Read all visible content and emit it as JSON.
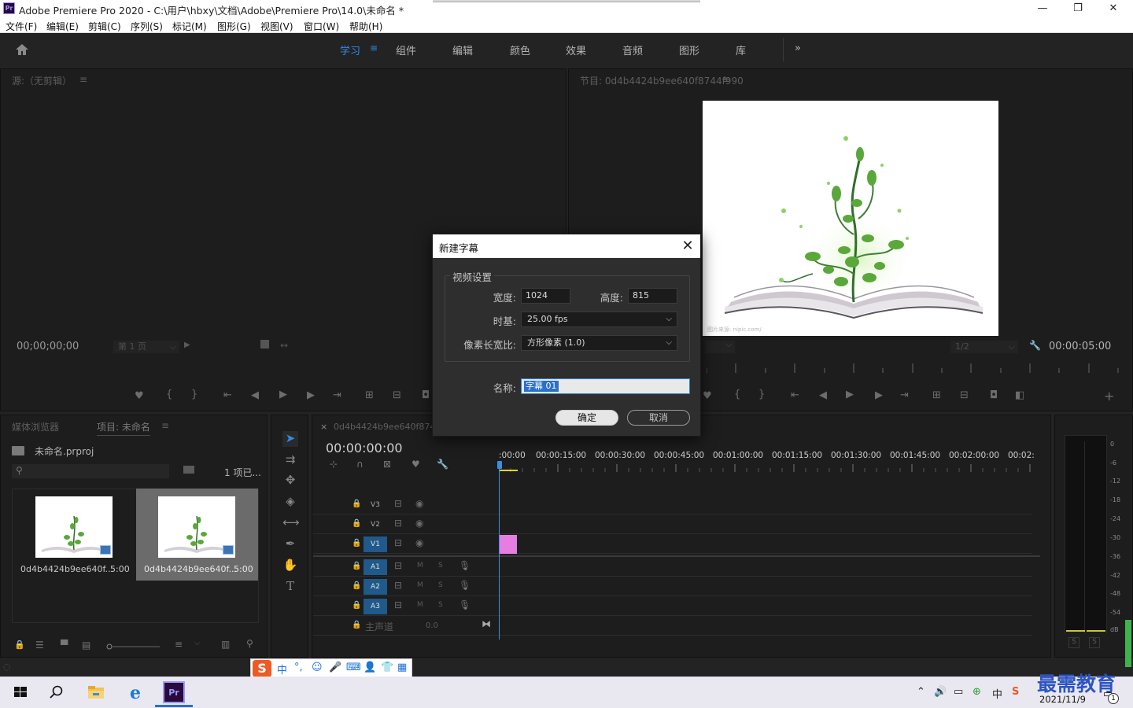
{
  "window": {
    "app_icon": "Pr",
    "title": "Adobe Premiere Pro 2020 - C:\\用户\\hbxy\\文档\\Adobe\\Premiere Pro\\14.0\\未命名 *",
    "minimize": "—",
    "maximize": "❐",
    "close": "✕"
  },
  "menu": [
    "文件(F)",
    "编辑(E)",
    "剪辑(C)",
    "序列(S)",
    "标记(M)",
    "图形(G)",
    "视图(V)",
    "窗口(W)",
    "帮助(H)"
  ],
  "workspaces": {
    "tabs": [
      "学习",
      "组件",
      "编辑",
      "颜色",
      "效果",
      "音频",
      "图形",
      "库"
    ],
    "active": "学习",
    "menu_glyph": "≡",
    "more": "»"
  },
  "source_monitor": {
    "title": "源:（无剪辑）",
    "menu_glyph": "≡",
    "timecode": "00;00;00;00",
    "page_select": "第 1 页"
  },
  "program_monitor": {
    "title": "节目: 0d4b4424b9ee640f8744f990",
    "menu_glyph": "≡",
    "timecode": "00:00:05:00",
    "resolution": "1/2",
    "frame_watermark": "图片来源: nipic.com/"
  },
  "project_panel": {
    "tabs": [
      "媒体浏览器",
      "项目: 未命名"
    ],
    "menu_glyph": "≡",
    "project_file": "未命名.prproj",
    "item_count": "1 项已...",
    "items": [
      {
        "name": "0d4b4424b9ee640f...",
        "duration": "5:00"
      },
      {
        "name": "0d4b4424b9ee640f...",
        "duration": "5:00"
      }
    ]
  },
  "timeline": {
    "tab": "0d4b4424b9ee640f8744f",
    "close_glyph": "×",
    "timecode": "00:00:00:00",
    "ruler": [
      ":00:00",
      "00:00:15:00",
      "00:00:30:00",
      "00:00:45:00",
      "00:01:00:00",
      "00:01:15:00",
      "00:01:30:00",
      "00:01:45:00",
      "00:02:00:00",
      "00:02:"
    ],
    "video_tracks": [
      "V3",
      "V2",
      "V1"
    ],
    "audio_tracks": [
      "A1",
      "A2",
      "A3"
    ],
    "master_label": "主声道",
    "master_value": "0.0",
    "track_m": "M",
    "track_s": "S",
    "clip_color": "#e57ee0"
  },
  "meter": {
    "db_ticks": [
      "0",
      "-6",
      "-12",
      "-18",
      "-24",
      "-30",
      "-36",
      "-42",
      "-48",
      "-54",
      "dB"
    ],
    "solo": [
      "S",
      "S"
    ]
  },
  "dialog": {
    "title": "新建字幕",
    "close": "✕",
    "group_title": "视频设置",
    "width_label": "宽度:",
    "width_value": "1024",
    "height_label": "高度:",
    "height_value": "815",
    "timebase_label": "时基:",
    "timebase_value": "25.00 fps",
    "pixel_aspect_label": "像素长宽比:",
    "pixel_aspect_value": "方形像素 (1.0)",
    "name_label": "名称:",
    "name_value": "字幕 01",
    "ok": "确定",
    "cancel": "取消"
  },
  "ime": {
    "logo": "S",
    "mode": "中",
    "punct": "°,"
  },
  "taskbar": {
    "tray_ime": "中",
    "date": "2021/11/9",
    "watermark": "最需教育",
    "notification_count": "1"
  }
}
